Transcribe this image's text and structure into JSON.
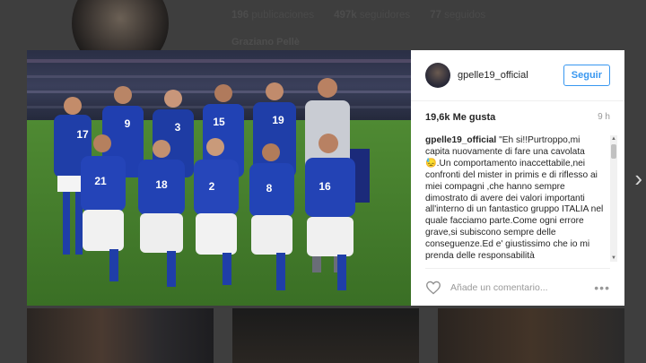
{
  "profile": {
    "posts_count": "196",
    "posts_label": "publicaciones",
    "followers_count": "497k",
    "followers_label": "seguidores",
    "following_count": "77",
    "following_label": "seguidos",
    "full_name": "Graziano Pellè"
  },
  "post": {
    "username": "gpelle19_official",
    "follow_label": "Seguir",
    "likes": "19,6k Me gusta",
    "time_ago": "9 h",
    "caption_user": "gpelle19_official",
    "caption_text": " \"Eh si!!Purtroppo,mi capita nuovamente di fare una cavolata 😓.Un comportamento inaccettabile,nei confronti del mister in primis e di riflesso ai miei compagni ,che hanno sempre dimostrato di avere dei valori importanti all'interno di un fantastico gruppo ITALIA nel quale facciamo parte.Come ogni errore grave,si subiscono sempre delle conseguenze.Ed e' giustissimo che io mi prenda delle responsabilità",
    "comment_placeholder": "Añade un comentario...",
    "more_label": "•••",
    "jersey_numbers_back": [
      "17",
      "9",
      "3",
      "15",
      "19"
    ],
    "jersey_numbers_front": [
      "21",
      "18",
      "2",
      "8",
      "16"
    ]
  },
  "nav": {
    "next_arrow": "›"
  },
  "colors": {
    "accent": "#3897f0",
    "kit_blue": "#1f3ea8",
    "pitch": "#3f7d2a"
  }
}
